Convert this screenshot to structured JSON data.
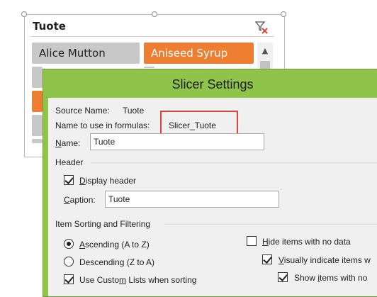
{
  "slicer": {
    "title": "Tuote",
    "items": [
      {
        "label": "Alice Mutton",
        "selected": false
      },
      {
        "label": "Aniseed Syrup",
        "selected": true
      }
    ],
    "colors": {
      "selected": "#ed7d31",
      "unselected": "#c8c8c8"
    },
    "icons": {
      "clear_filter": "clear-filter-icon",
      "scroll_up": "scroll-up-arrow-icon"
    }
  },
  "dialog": {
    "title": "Slicer Settings",
    "source_name_label": "Source Name:",
    "source_name_value": "Tuote",
    "formula_name_label": "Name to use in formulas:",
    "formula_name_value": "Slicer_Tuote",
    "name_label": "Name:",
    "name_value": "Tuote",
    "header_group": "Header",
    "display_header_label": "Display header",
    "display_header_checked": true,
    "caption_label": "Caption:",
    "caption_value": "Tuote",
    "sorting_group": "Item Sorting and Filtering",
    "ascending_label": "Ascending (A to Z)",
    "descending_label": "Descending (Z to A)",
    "sort_selected": "ascending",
    "custom_lists_label": "Use Custom Lists when sorting",
    "custom_lists_checked": true,
    "hide_items_label": "Hide items with no data",
    "hide_items_checked": false,
    "visually_indicate_label": "Visually indicate items w",
    "visually_indicate_checked": true,
    "show_items_label": "Show items with no",
    "show_items_checked": true,
    "accent_color": "#8fc34a",
    "highlight_color": "#d9463b"
  }
}
